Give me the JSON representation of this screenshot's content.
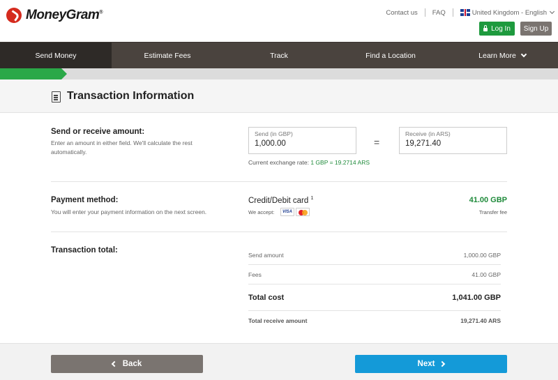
{
  "header": {
    "brand": "MoneyGram",
    "brand_mark": "®",
    "links": {
      "contact": "Contact us",
      "faq": "FAQ",
      "locale": "United Kingdom - English"
    },
    "login_label": "Log In",
    "signup_label": "Sign Up"
  },
  "nav": {
    "items": [
      {
        "label": "Send Money",
        "active": true
      },
      {
        "label": "Estimate Fees"
      },
      {
        "label": "Track"
      },
      {
        "label": "Find a Location"
      },
      {
        "label": "Learn More"
      }
    ]
  },
  "progress": {
    "fraction": 0.12
  },
  "page": {
    "title": "Transaction Information"
  },
  "amount_section": {
    "heading": "Send or receive amount:",
    "description": "Enter an amount in either field. We'll calculate the rest automatically.",
    "send": {
      "label": "Send (in GBP)",
      "value": "1,000.00"
    },
    "equals": "=",
    "receive": {
      "label": "Receive (in ARS)",
      "value": "19,271.40"
    },
    "rate_label": "Current exchange rate:",
    "rate_value": "1 GBP = 19.2714 ARS"
  },
  "payment_section": {
    "heading": "Payment method:",
    "description": "You will enter your payment information on the next screen.",
    "method": "Credit/Debit card",
    "method_note": "1",
    "accept_label": "We accept:",
    "card_visa": "VISA",
    "fee_amount": "41.00 GBP",
    "fee_label": "Transfer fee"
  },
  "total_section": {
    "heading": "Transaction total:",
    "rows": [
      {
        "key": "Send amount",
        "value": "1,000.00 GBP"
      },
      {
        "key": "Fees",
        "value": "41.00 GBP"
      },
      {
        "key": "Total cost",
        "value": "1,041.00 GBP"
      },
      {
        "key": "Total receive amount",
        "value": "19,271.40 ARS"
      }
    ]
  },
  "footer": {
    "back_label": "Back",
    "next_label": "Next"
  },
  "colors": {
    "accent_green": "#2aa848",
    "nav_bg": "#4a433e",
    "next_blue": "#149ad8",
    "back_gray": "#7a7470"
  }
}
